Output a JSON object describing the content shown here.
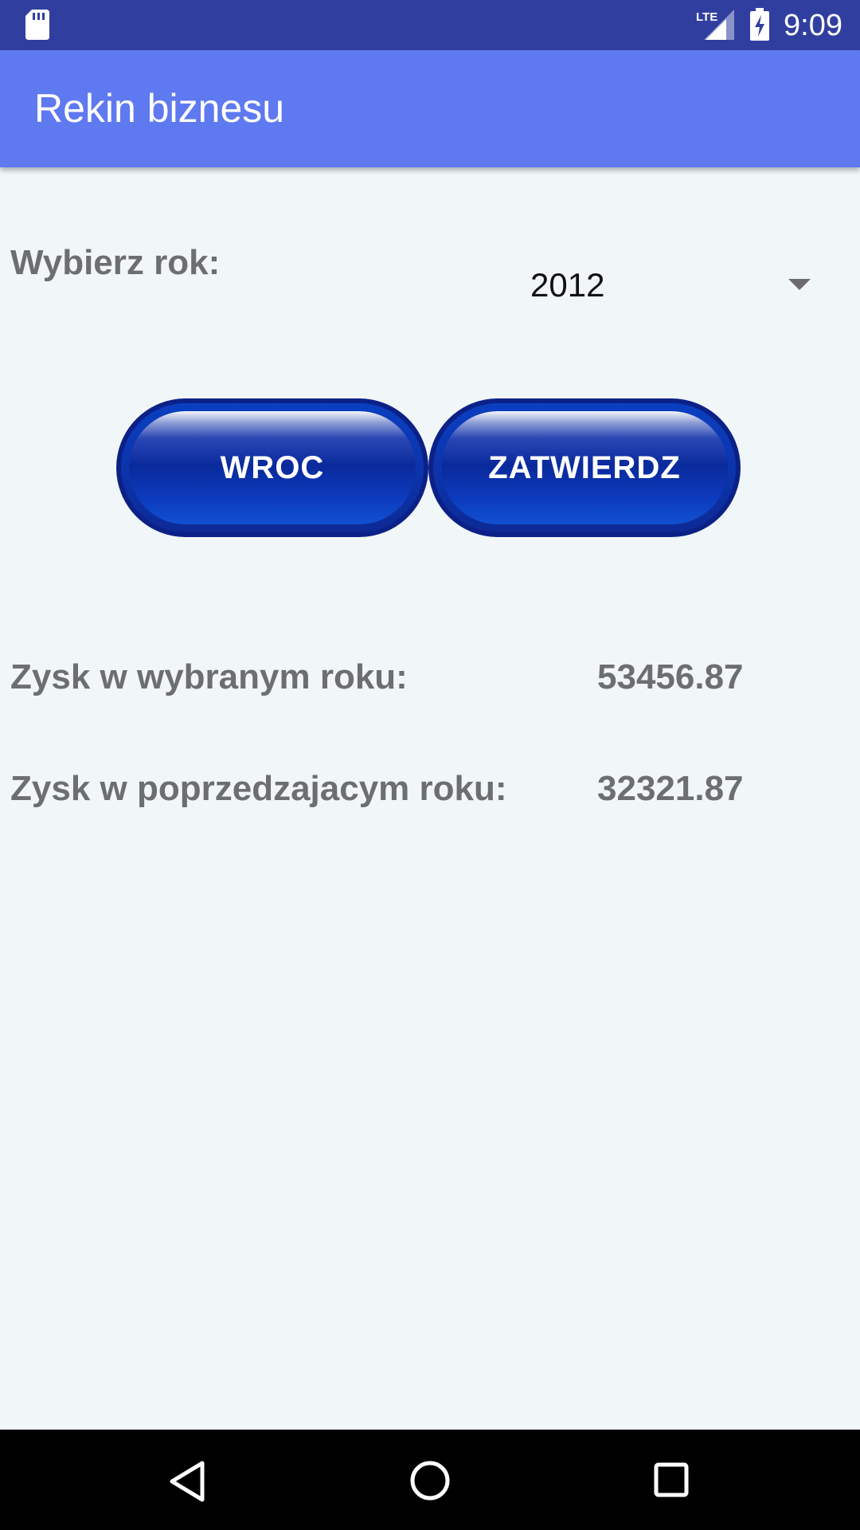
{
  "status_bar": {
    "time": "9:09",
    "network_label": "LTE",
    "icons": [
      "sd-card-icon",
      "lte-signal-icon",
      "battery-charging-icon"
    ]
  },
  "app_bar": {
    "title": "Rekin biznesu",
    "color": "#5f79f0"
  },
  "year_select": {
    "label": "Wybierz rok:",
    "selected": "2012"
  },
  "buttons": {
    "back_label": "WROC",
    "confirm_label": "ZATWIERDZ",
    "color": "#0a2a9c"
  },
  "results": {
    "selected_year_label": "Zysk w wybranym roku:",
    "selected_year_value": "53456.87",
    "previous_year_label": "Zysk w poprzedzajacym roku:",
    "previous_year_value": "32321.87"
  },
  "nav_bar": {
    "icons": [
      "back-triangle-icon",
      "home-circle-icon",
      "recents-square-icon"
    ]
  },
  "colors": {
    "status_bar": "#303f9f",
    "background": "#f1f6f9",
    "text_gray": "#6c6e70"
  }
}
